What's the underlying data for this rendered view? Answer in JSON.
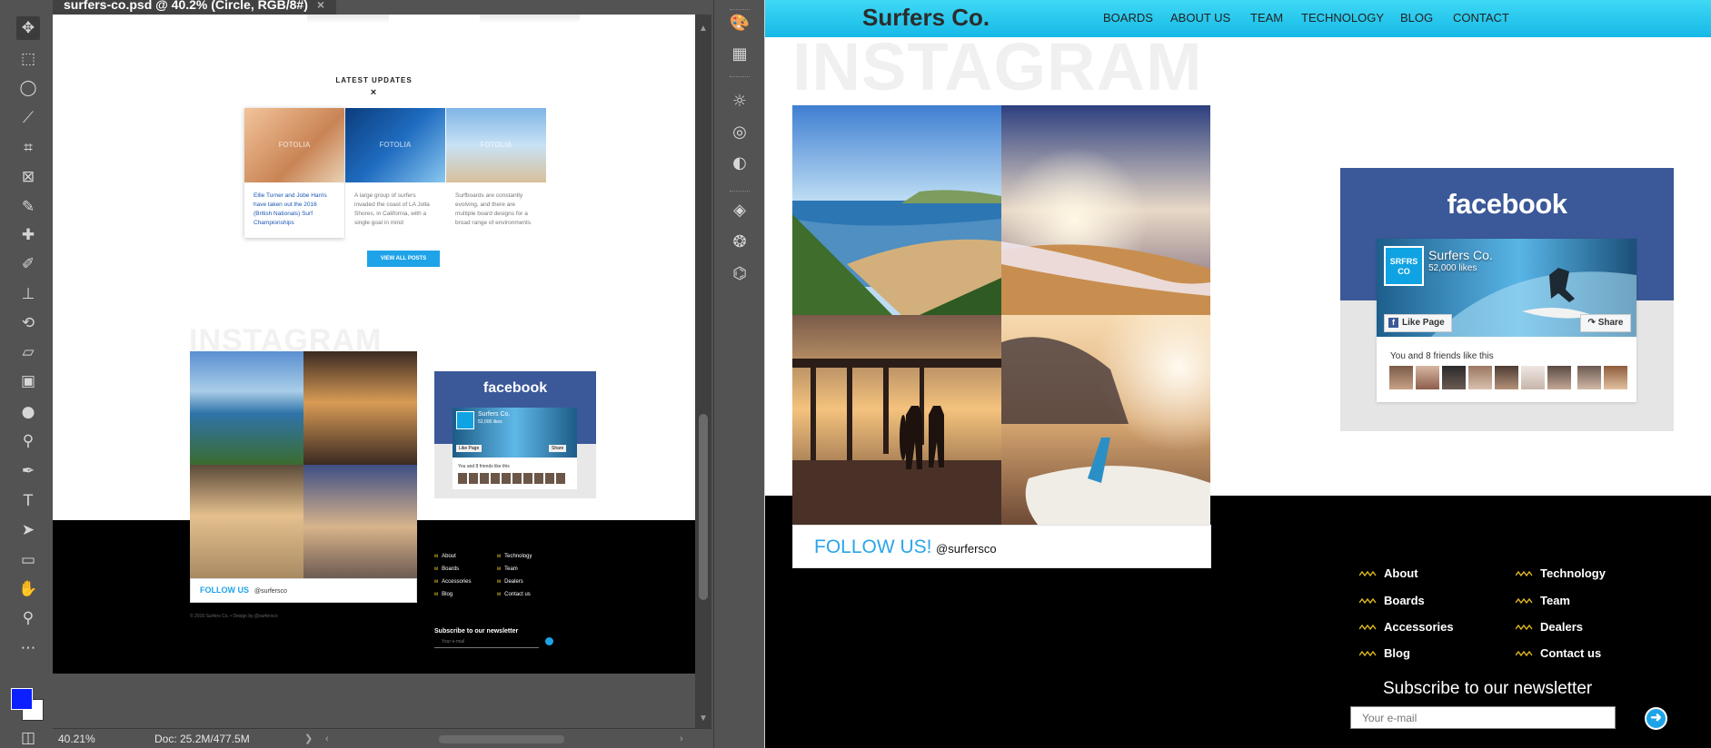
{
  "photoshop": {
    "tab_title": "surfers-co.psd @ 40.2% (Circle, RGB/8#)",
    "tab_close": "×",
    "zoom": "40.21%",
    "doc_size": "Doc: 25.2M/477.5M",
    "foreground_color": "#0b1fff",
    "background_color": "#ffffff",
    "tools": [
      "move-icon",
      "marquee-icon",
      "lasso-icon",
      "quick-select-icon",
      "crop-icon",
      "frame-icon",
      "eyedropper-icon",
      "healing-icon",
      "brush-icon",
      "stamp-icon",
      "history-brush-icon",
      "eraser-icon",
      "gradient-icon",
      "blur-icon",
      "dodge-icon",
      "pen-icon",
      "type-icon",
      "path-select-icon",
      "rectangle-icon",
      "hand-icon",
      "zoom-icon",
      "more-icon"
    ],
    "panels": [
      "color-icon",
      "swatches-icon",
      "learn-icon",
      "libraries-icon",
      "adjustments-icon",
      "layers-icon",
      "channels-icon",
      "paths-icon"
    ],
    "mini_page": {
      "section_title": "LATEST UPDATES",
      "section_mark": "×",
      "watermark": "FOTOLIA",
      "posts": [
        "Ellie Turner and Jobe Harris have taken out the 2016 (British Nationals) Surf Championships",
        "A large group of surfers invaded the coast of LA Jolla Shores, in California, with a single goal in mind",
        "Surfboards are constantly evolving, and there are multiple board designs for a broad range of environments"
      ],
      "button": "VIEW ALL POSTS",
      "insta_title": "INSTAGRAM",
      "follow": "FOLLOW US",
      "handle": "@surfersco",
      "fb_logo": "facebook",
      "fb_name": "Surfers Co.",
      "fb_likes": "52,000 likes",
      "fb_like": "Like Page",
      "fb_share": "Share",
      "fb_friends": "You and 8 friends like this",
      "links_col1": [
        "About",
        "Boards",
        "Accessories",
        "Blog"
      ],
      "links_col2": [
        "Technology",
        "Team",
        "Dealers",
        "Contact us"
      ],
      "copyright": "© 2016 Surfers Co.  •  Design by @surfersco",
      "subscribe": "Subscribe to our newsletter",
      "email_placeholder": "Your e-mail"
    }
  },
  "site": {
    "brand": "Surfers Co.",
    "nav": [
      "BOARDS",
      "ABOUT US",
      "TEAM",
      "TECHNOLOGY",
      "BLOG",
      "CONTACT"
    ],
    "insta_title": "INSTAGRAM",
    "follow_label": "FOLLOW US!",
    "follow_handle": "@surfersco",
    "facebook": {
      "logo": "facebook",
      "profile_badge": "SRFRS CO",
      "page_name": "Surfers Co.",
      "likes": "52,000 likes",
      "like_button": "Like Page",
      "share_button": "Share",
      "friends_text": "You and 8 friends like this"
    },
    "footer_links_col1": [
      "About",
      "Boards",
      "Accessories",
      "Blog"
    ],
    "footer_links_col2": [
      "Technology",
      "Team",
      "Dealers",
      "Contact us"
    ],
    "newsletter_title": "Subscribe to our newsletter",
    "email_placeholder": "Your e-mail",
    "accent_color": "#1fa3e8",
    "nav_color": "#22c4ee",
    "facebook_color": "#3b5998"
  }
}
